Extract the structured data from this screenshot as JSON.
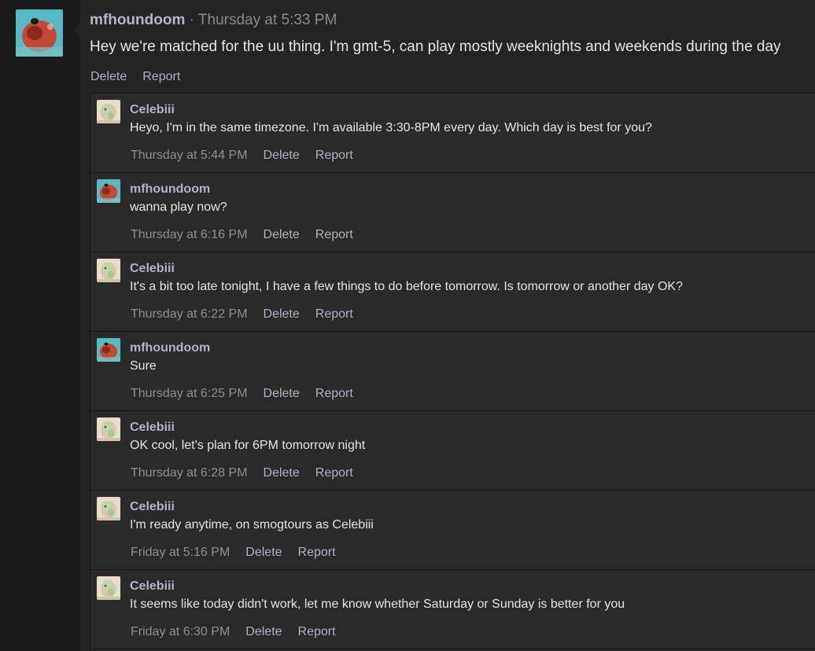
{
  "post": {
    "author": "mfhoundoom",
    "separator": "·",
    "date": "Thursday at 5:33 PM",
    "body": "Hey we're matched for the uu thing. I'm gmt-5, can play mostly weeknights and weekends during the day",
    "actions": {
      "delete": "Delete",
      "report": "Report"
    }
  },
  "replies": [
    {
      "author": "Celebiii",
      "text": "Heyo, I'm in the same timezone. I'm available 3:30-8PM every day. Which day is best for you?",
      "time": "Thursday at 5:44 PM",
      "delete": "Delete",
      "report": "Report",
      "avatar": "celebi"
    },
    {
      "author": "mfhoundoom",
      "text": "wanna play now?",
      "time": "Thursday at 6:16 PM",
      "delete": "Delete",
      "report": "Report",
      "avatar": "houndoom"
    },
    {
      "author": "Celebiii",
      "text": "It's a bit too late tonight, I have a few things to do before tomorrow. Is tomorrow or another day OK?",
      "time": "Thursday at 6:22 PM",
      "delete": "Delete",
      "report": "Report",
      "avatar": "celebi"
    },
    {
      "author": "mfhoundoom",
      "text": "Sure",
      "time": "Thursday at 6:25 PM",
      "delete": "Delete",
      "report": "Report",
      "avatar": "houndoom"
    },
    {
      "author": "Celebiii",
      "text": "OK cool, let's plan for 6PM tomorrow night",
      "time": "Thursday at 6:28 PM",
      "delete": "Delete",
      "report": "Report",
      "avatar": "celebi"
    },
    {
      "author": "Celebiii",
      "text": "I'm ready anytime, on smogtours as Celebiii",
      "time": "Friday at 5:16 PM",
      "delete": "Delete",
      "report": "Report",
      "avatar": "celebi"
    },
    {
      "author": "Celebiii",
      "text": "It seems like today didn't work, let me know whether Saturday or Sunday is better for you",
      "time": "Friday at 6:30 PM",
      "delete": "Delete",
      "report": "Report",
      "avatar": "celebi"
    }
  ],
  "colors": {
    "username": "#b8b2cd",
    "link": "#b3aec8",
    "timestamp": "#8e8e8e",
    "body_text": "#e4e4e4",
    "background": "#242424"
  }
}
